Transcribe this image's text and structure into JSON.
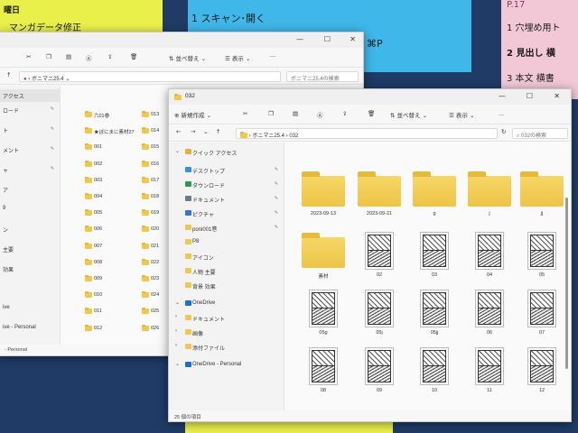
{
  "notes": {
    "yellow_lines": [
      "曜日",
      "マンガデータ修正"
    ],
    "blue_lines": [
      "1 スキャン･開く",
      "⌘P"
    ],
    "pink_lines": [
      "P.17",
      "1 穴埋め用ト",
      "2 見出し 横",
      "3 本文 横書"
    ]
  },
  "back_window": {
    "breadcrumb": "ボニマニ25.4",
    "search_placeholder": "ボニマニ25.4の検索",
    "sort_label": "並べ替え",
    "view_label": "表示",
    "nav_items": [
      "アクセス",
      "ロード",
      "ト",
      "メント",
      "ャ",
      "ア",
      "9",
      "ン",
      "主要",
      "効果",
      "ive",
      "ive - Personal"
    ],
    "status": "- Personal",
    "col1": [
      "六01巻",
      "★ぼにまに素材27",
      "001",
      "002",
      "003",
      "004",
      "005",
      "006",
      "007",
      "008",
      "009",
      "010",
      "011",
      "012"
    ],
    "col2": [
      "013",
      "014",
      "015",
      "016",
      "017",
      "018",
      "019",
      "020",
      "021",
      "022",
      "023",
      "024",
      "025",
      "026"
    ]
  },
  "front_window": {
    "title": "032",
    "new_label": "新規作成",
    "sort_label": "並べ替え",
    "view_label": "表示",
    "more_label": "...",
    "breadcrumb": [
      "ボニマニ25.4",
      "032"
    ],
    "search_placeholder": "032の検索",
    "nav_items": [
      {
        "label": "クイック アクセス",
        "icon": "star-icon",
        "pinned": false
      },
      {
        "label": "デスクトップ",
        "icon": "desktop-icon",
        "pinned": true
      },
      {
        "label": "ダウンロード",
        "icon": "download-icon",
        "pinned": true
      },
      {
        "label": "ドキュメント",
        "icon": "document-icon",
        "pinned": true
      },
      {
        "label": "ピクチャ",
        "icon": "picture-icon",
        "pinned": true
      },
      {
        "label": "poni001巻",
        "icon": "folder-icon",
        "pinned": true
      },
      {
        "label": "P8",
        "icon": "folder-icon",
        "pinned": false
      },
      {
        "label": "アイコン",
        "icon": "folder-icon",
        "pinned": false
      },
      {
        "label": "人物 主要",
        "icon": "folder-icon",
        "pinned": false
      },
      {
        "label": "背景 効果",
        "icon": "folder-icon",
        "pinned": false
      },
      {
        "label": "OneDrive",
        "icon": "cloud-icon",
        "pinned": false
      },
      {
        "label": "ドキュメント",
        "icon": "folder-icon",
        "pinned": false
      },
      {
        "label": "画像",
        "icon": "folder-icon",
        "pinned": false
      },
      {
        "label": "添付ファイル",
        "icon": "folder-icon",
        "pinned": false
      },
      {
        "label": "OneDrive - Personal",
        "icon": "cloud-icon",
        "pinned": false
      }
    ],
    "items": [
      {
        "label": "2023-09-13",
        "kind": "folder"
      },
      {
        "label": "2023-09-21",
        "kind": "folder"
      },
      {
        "label": "g",
        "kind": "folder"
      },
      {
        "label": "j",
        "kind": "folder"
      },
      {
        "label": "jj",
        "kind": "folder"
      },
      {
        "label": "素材",
        "kind": "folder"
      },
      {
        "label": "02",
        "kind": "image"
      },
      {
        "label": "03",
        "kind": "image"
      },
      {
        "label": "04",
        "kind": "image"
      },
      {
        "label": "05",
        "kind": "image"
      },
      {
        "label": "05g",
        "kind": "image"
      },
      {
        "label": "05j",
        "kind": "image"
      },
      {
        "label": "05jj",
        "kind": "image"
      },
      {
        "label": "06",
        "kind": "image"
      },
      {
        "label": "07",
        "kind": "image"
      },
      {
        "label": "08",
        "kind": "image"
      },
      {
        "label": "09",
        "kind": "image"
      },
      {
        "label": "10",
        "kind": "image"
      },
      {
        "label": "11",
        "kind": "image"
      },
      {
        "label": "12",
        "kind": "image"
      }
    ],
    "status": "25 個の項目",
    "colors": {
      "folder": "#f0c94a",
      "accent": "#1a6fd6"
    }
  }
}
